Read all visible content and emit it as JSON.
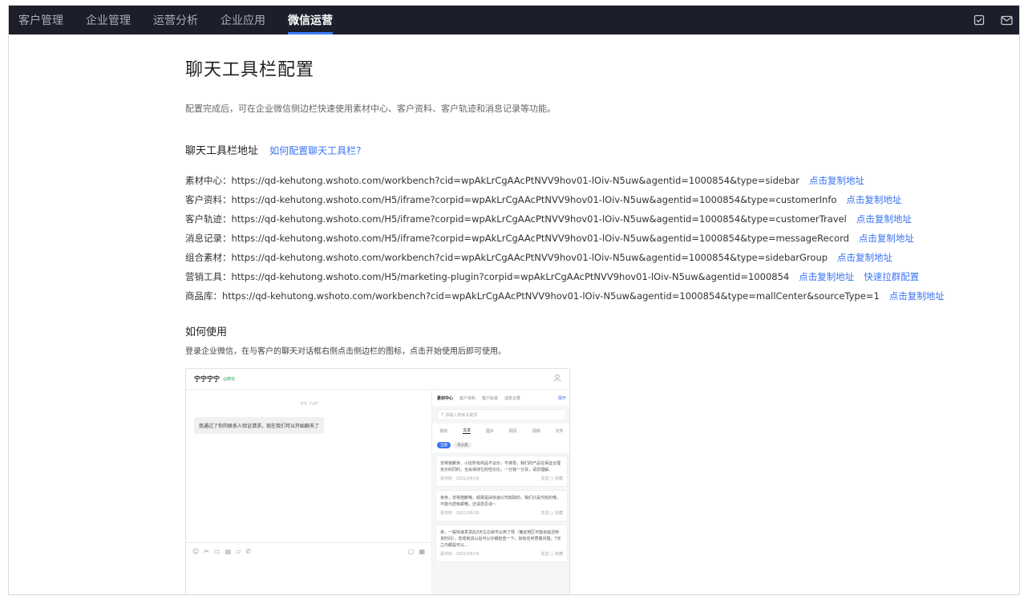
{
  "nav": {
    "items": [
      "客户管理",
      "企业管理",
      "运营分析",
      "企业应用",
      "微信运营"
    ],
    "active": "微信运营",
    "icons": [
      "checklist-icon",
      "mail-icon"
    ]
  },
  "page": {
    "title": "聊天工具栏配置",
    "intro": "配置完成后，可在企业微信侧边栏快速使用素材中心、客户资料、客户轨迹和消息记录等功能。"
  },
  "address_section": {
    "title": "聊天工具栏地址",
    "help_link": "如何配置聊天工具栏?"
  },
  "urls": [
    {
      "label": "素材中心：",
      "url": "https://qd-kehutong.wshoto.com/workbench?cid=wpAkLrCgAAcPtNVV9hov01-lOiv-N5uw&agentid=1000854&type=sidebar",
      "copy": "点击复制地址"
    },
    {
      "label": "客户资料：",
      "url": "https://qd-kehutong.wshoto.com/H5/iframe?corpid=wpAkLrCgAAcPtNVV9hov01-lOiv-N5uw&agentid=1000854&type=customerInfo",
      "copy": "点击复制地址"
    },
    {
      "label": "客户轨迹：",
      "url": "https://qd-kehutong.wshoto.com/H5/iframe?corpid=wpAkLrCgAAcPtNVV9hov01-lOiv-N5uw&agentid=1000854&type=customerTravel",
      "copy": "点击复制地址"
    },
    {
      "label": "消息记录：",
      "url": "https://qd-kehutong.wshoto.com/H5/iframe?corpid=wpAkLrCgAAcPtNVV9hov01-lOiv-N5uw&agentid=1000854&type=messageRecord",
      "copy": "点击复制地址"
    },
    {
      "label": "组合素材：",
      "url": "https://qd-kehutong.wshoto.com/workbench?cid=wpAkLrCgAAcPtNVV9hov01-lOiv-N5uw&agentid=1000854&type=sidebarGroup",
      "copy": "点击复制地址"
    },
    {
      "label": "营销工具：",
      "url": "https://qd-kehutong.wshoto.com/H5/marketing-plugin?corpid=wpAkLrCgAAcPtNVV9hov01-lOiv-N5uw&agentid=1000854",
      "copy": "点击复制地址",
      "extra": "快速拉群配置"
    },
    {
      "label": "商品库：",
      "url": "https://qd-kehutong.wshoto.com/workbench?cid=wpAkLrCgAAcPtNVV9hov01-lOiv-N5uw&agentid=1000854&type=mallCenter&sourceType=1",
      "copy": "点击复制地址"
    }
  ],
  "usage": {
    "title": "如何使用",
    "desc": "登录企业微信，在与客户的聊天对话框右侧点击侧边栏的图标，点击开始使用后即可使用。"
  },
  "mock": {
    "name": "宁宁宁宁",
    "tag": "@微信",
    "time": "下午 7:07",
    "bubble": "我通过了你的联系人验证请求，现在我们可以开始聊天了",
    "side_tabs": [
      "素材中心",
      "客户资料",
      "客户轨迹",
      "消息记录"
    ],
    "side_more": "展开",
    "search_placeholder": "请输入搜索关键词",
    "types": [
      "我的",
      "文本",
      "图片",
      "网页",
      "视频",
      "文件"
    ],
    "chips": [
      "全部",
      "未分类"
    ],
    "cards": [
      {
        "text": "非常抱歉亲，小店所有商品不议价，不抹零。我们的产品在保证合理定价的同时，也会保持它的性价比，一分钱一分货，请您理解。",
        "meta": "素材库 · 2021/06/16",
        "act": "发送 ○ 收藏"
      },
      {
        "text": "亲亲，非常抱歉哦，邮费是由快递公司收取的，我们只是代收的哦，不能为您免邮哦，还请您见谅~",
        "meta": "素材库 · 2021/06/16",
        "act": "发送 ○ 收藏"
      },
      {
        "text": "亲，一般快递发货后3天左右就可以到了呢（偏远地区可能会延迟到货时间），您收到货以后可以仔细检查一下，如有任何质量问题，7天之内都是可以...",
        "meta": "素材库 · 2021/06/16",
        "act": "发送 ○ 收藏"
      }
    ]
  }
}
